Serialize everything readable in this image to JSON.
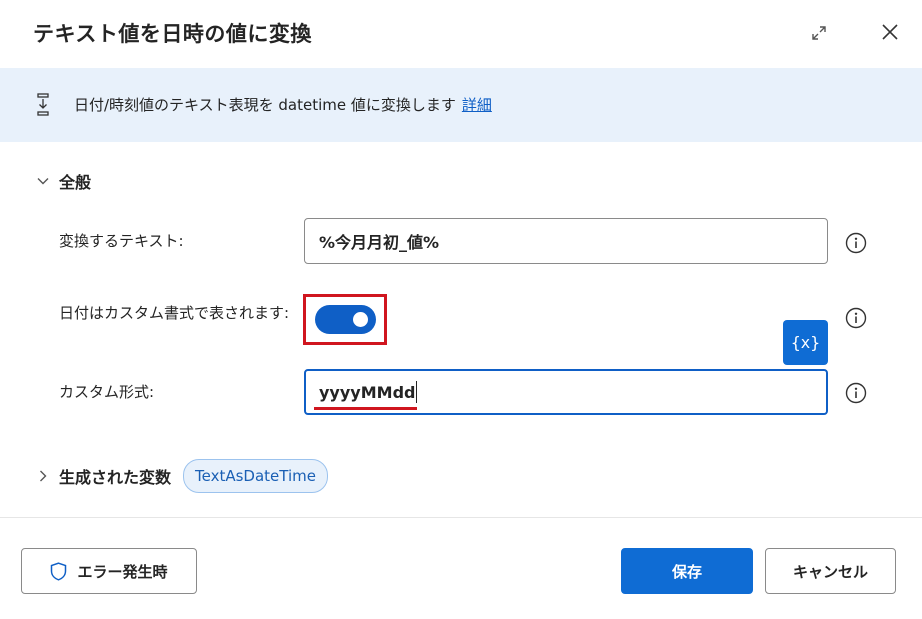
{
  "dialog": {
    "title": "テキスト値を日時の値に変換",
    "icons": {
      "expand": "expand-icon",
      "close": "close-icon"
    }
  },
  "banner": {
    "text": "日付/時刻値のテキスト表現を datetime 値に変換します",
    "link": "詳細",
    "icon": "action-icon"
  },
  "general": {
    "label": "全般",
    "fields": {
      "text_to_convert": {
        "label": "変換するテキスト:",
        "value": "%今月月初_値%"
      },
      "custom_format_toggle": {
        "label": "日付はカスタム書式で表されます:",
        "on": true
      },
      "custom_format": {
        "label": "カスタム形式:",
        "value": "yyyyMMdd"
      }
    },
    "var_button": "{x}"
  },
  "generated_vars": {
    "label": "生成された変数",
    "chip": "TextAsDateTime"
  },
  "footer": {
    "on_error": "エラー発生時",
    "save": "保存",
    "cancel": "キャンセル"
  },
  "colors": {
    "accent": "#0f6cd4",
    "highlight": "#d0161f",
    "banner_bg": "#e8f1fb"
  }
}
